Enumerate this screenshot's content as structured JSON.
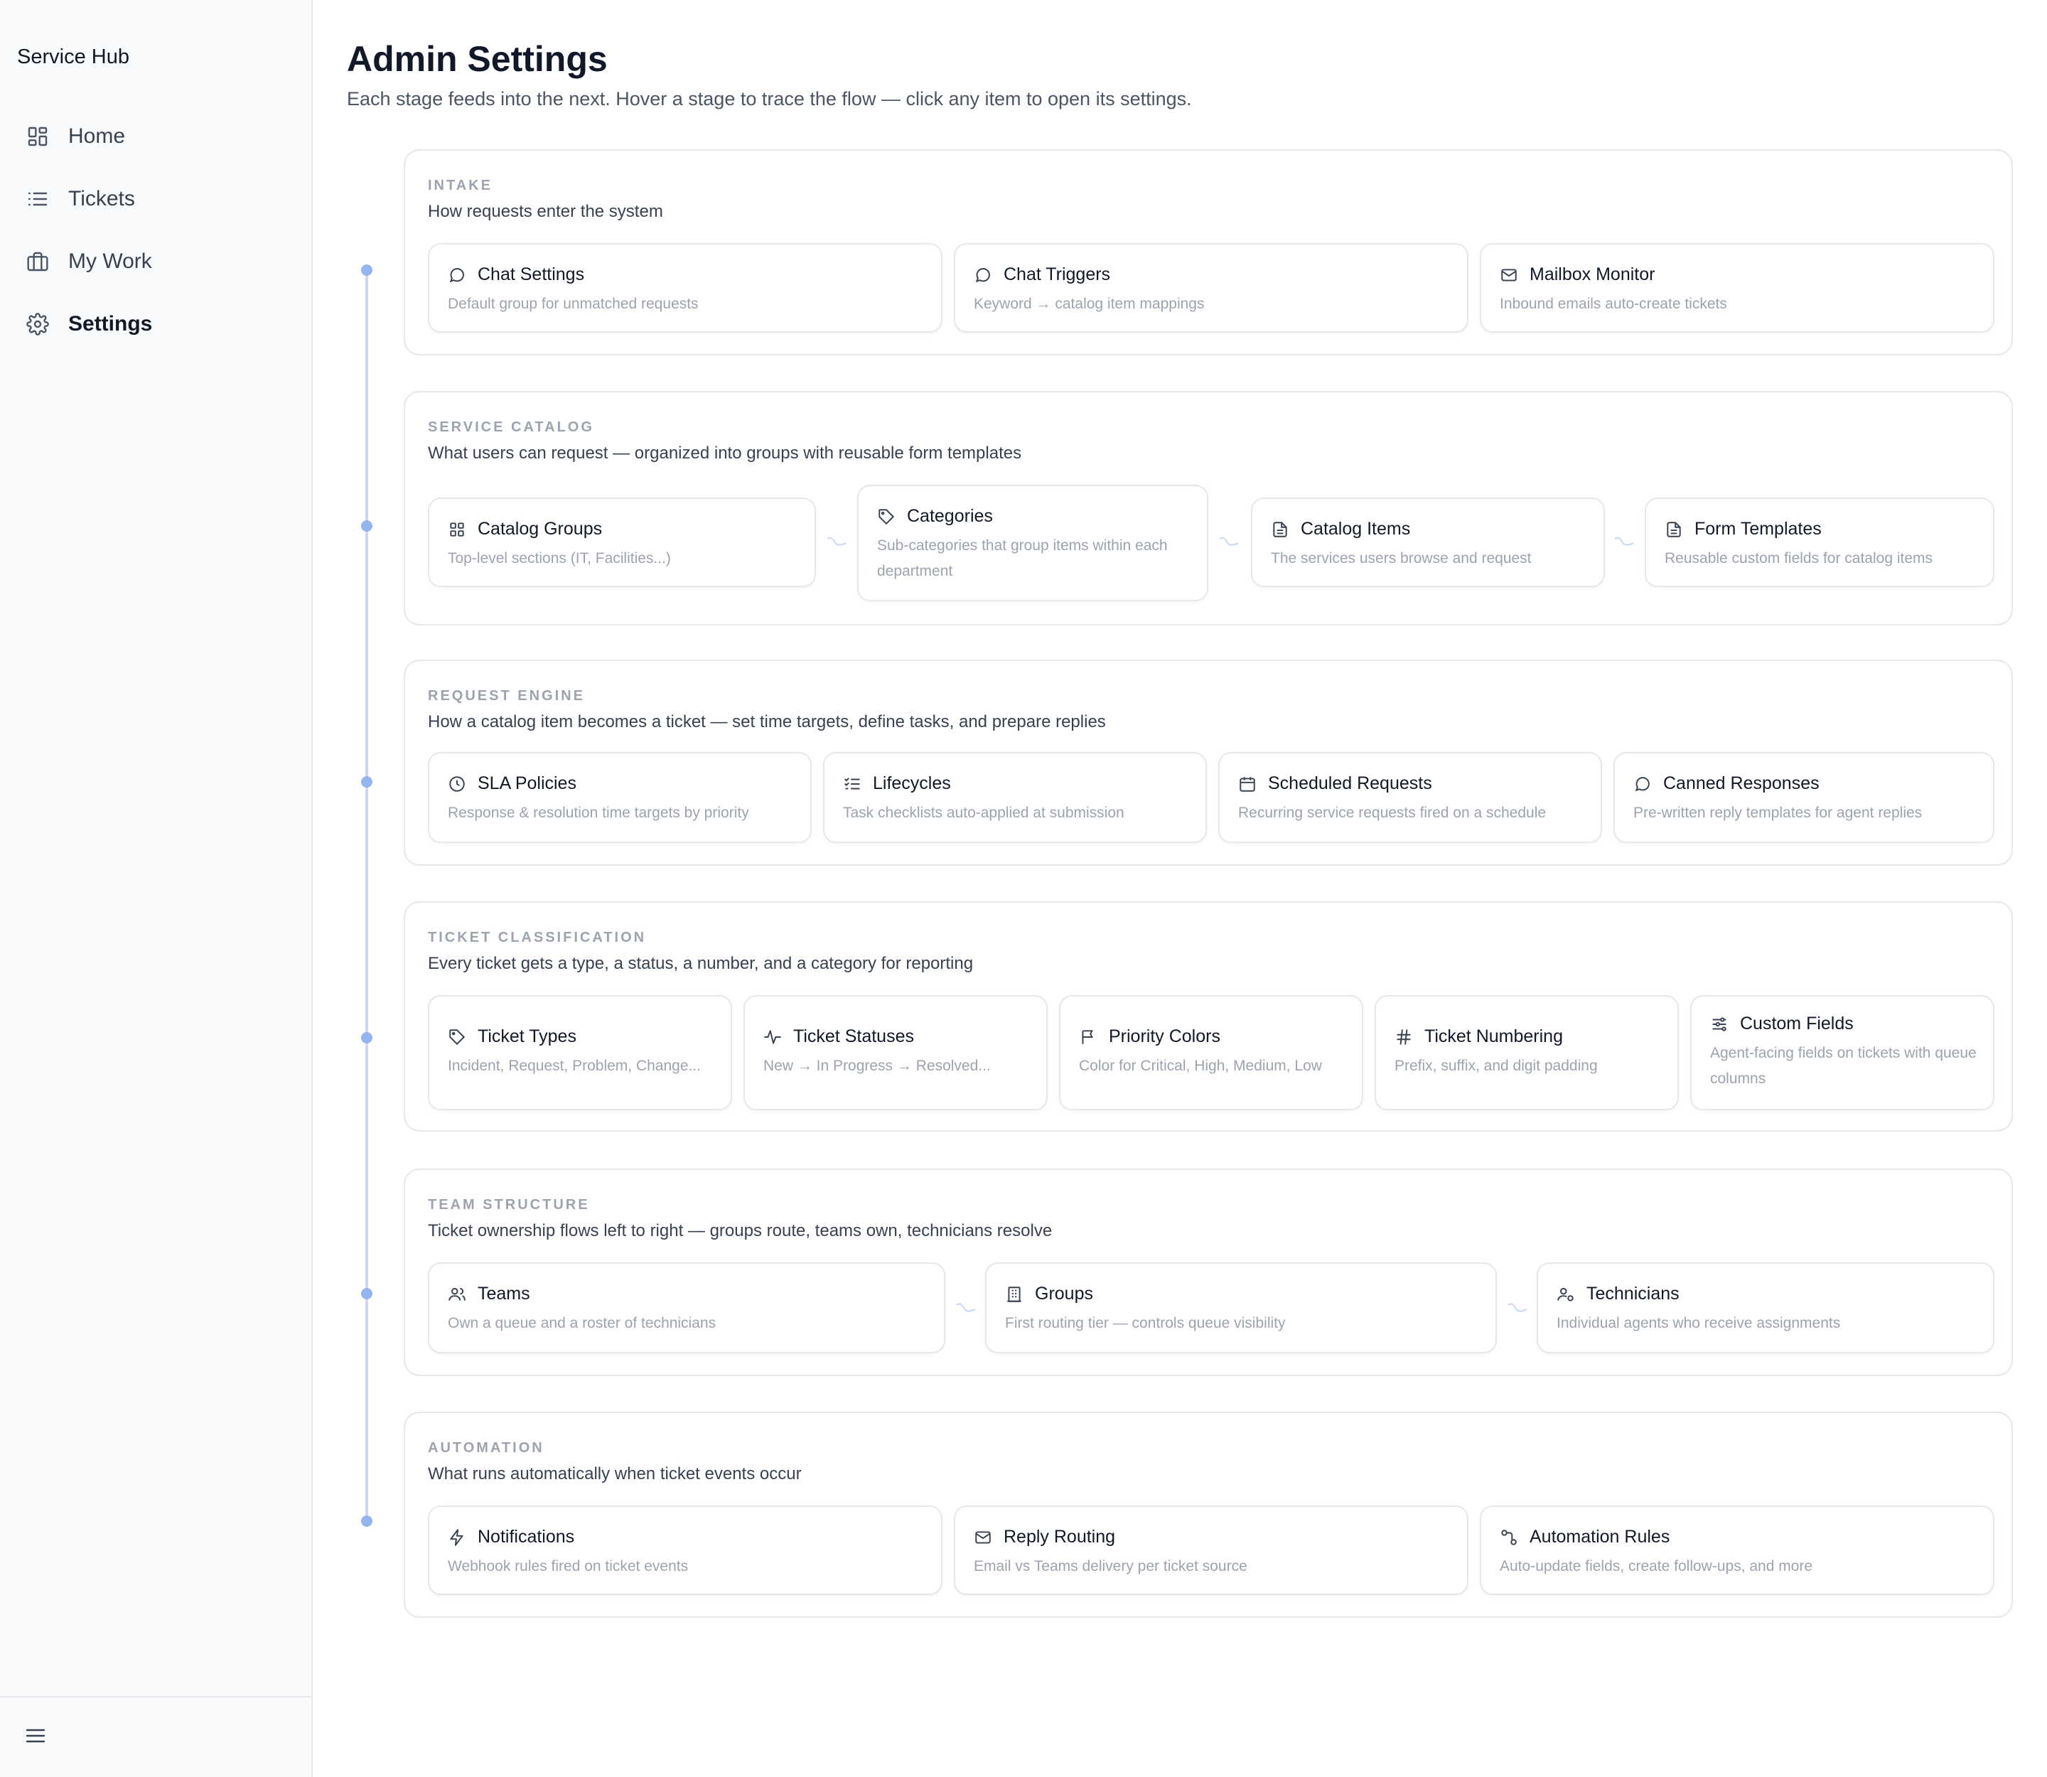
{
  "app": {
    "title": "Service Hub"
  },
  "nav": [
    {
      "label": "Home",
      "icon": "dashboard-icon"
    },
    {
      "label": "Tickets",
      "icon": "list-icon"
    },
    {
      "label": "My Work",
      "icon": "briefcase-icon"
    },
    {
      "label": "Settings",
      "icon": "gear-icon",
      "active": true
    }
  ],
  "page": {
    "title": "Admin Settings",
    "subtitle": "Each stage feeds into the next. Hover a stage to trace the flow — click any item to open its settings."
  },
  "stages": [
    {
      "label": "INTAKE",
      "desc": "How requests enter the system",
      "items": [
        {
          "title": "Chat Settings",
          "desc": "Default group for unmatched requests",
          "icon": "chat-icon"
        },
        {
          "title": "Chat Triggers",
          "desc": "Keyword → catalog item mappings",
          "icon": "chat-icon"
        },
        {
          "title": "Mailbox Monitor",
          "desc": "Inbound emails auto-create tickets",
          "icon": "mail-icon"
        }
      ]
    },
    {
      "label": "SERVICE CATALOG",
      "desc": "What users can request — organized into groups with reusable form templates",
      "items": [
        {
          "title": "Catalog Groups",
          "desc": "Top-level sections (IT, Facilities...)",
          "icon": "grid-icon"
        },
        {
          "title": "Categories",
          "desc": "Sub-categories that group items within each department",
          "icon": "tag-icon"
        },
        {
          "title": "Catalog Items",
          "desc": "The services users browse and request",
          "icon": "document-icon"
        },
        {
          "title": "Form Templates",
          "desc": "Reusable custom fields for catalog items",
          "icon": "document-icon"
        }
      ]
    },
    {
      "label": "REQUEST ENGINE",
      "desc": "How a catalog item becomes a ticket — set time targets, define tasks, and prepare replies",
      "items": [
        {
          "title": "SLA Policies",
          "desc": "Response & resolution time targets by priority",
          "icon": "clock-icon"
        },
        {
          "title": "Lifecycles",
          "desc": "Task checklists auto-applied at submission",
          "icon": "checklist-icon"
        },
        {
          "title": "Scheduled Requests",
          "desc": "Recurring service requests fired on a schedule",
          "icon": "calendar-icon"
        },
        {
          "title": "Canned Responses",
          "desc": "Pre-written reply templates for agent replies",
          "icon": "chat-icon"
        }
      ]
    },
    {
      "label": "TICKET CLASSIFICATION",
      "desc": "Every ticket gets a type, a status, a number, and a category for reporting",
      "items": [
        {
          "title": "Ticket Types",
          "desc": "Incident, Request, Problem, Change...",
          "icon": "tag-icon"
        },
        {
          "title": "Ticket Statuses",
          "desc": "New → In Progress → Resolved...",
          "icon": "activity-icon"
        },
        {
          "title": "Priority Colors",
          "desc": "Color for Critical, High, Medium, Low",
          "icon": "flag-icon"
        },
        {
          "title": "Ticket Numbering",
          "desc": "Prefix, suffix, and digit padding",
          "icon": "hash-icon"
        },
        {
          "title": "Custom Fields",
          "desc": "Agent-facing fields on tickets with queue columns",
          "icon": "sliders-icon"
        }
      ]
    },
    {
      "label": "TEAM STRUCTURE",
      "desc": "Ticket ownership flows left to right — groups route, teams own, technicians resolve",
      "items": [
        {
          "title": "Teams",
          "desc": "Own a queue and a roster of technicians",
          "icon": "users-icon"
        },
        {
          "title": "Groups",
          "desc": "First routing tier — controls queue visibility",
          "icon": "building-icon"
        },
        {
          "title": "Technicians",
          "desc": "Individual agents who receive assignments",
          "icon": "user-cog-icon"
        }
      ]
    },
    {
      "label": "AUTOMATION",
      "desc": "What runs automatically when ticket events occur",
      "items": [
        {
          "title": "Notifications",
          "desc": "Webhook rules fired on ticket events",
          "icon": "bolt-icon"
        },
        {
          "title": "Reply Routing",
          "desc": "Email vs Teams delivery per ticket source",
          "icon": "mail-icon"
        },
        {
          "title": "Automation Rules",
          "desc": "Auto-update fields, create follow-ups, and more",
          "icon": "workflow-icon"
        }
      ]
    }
  ]
}
